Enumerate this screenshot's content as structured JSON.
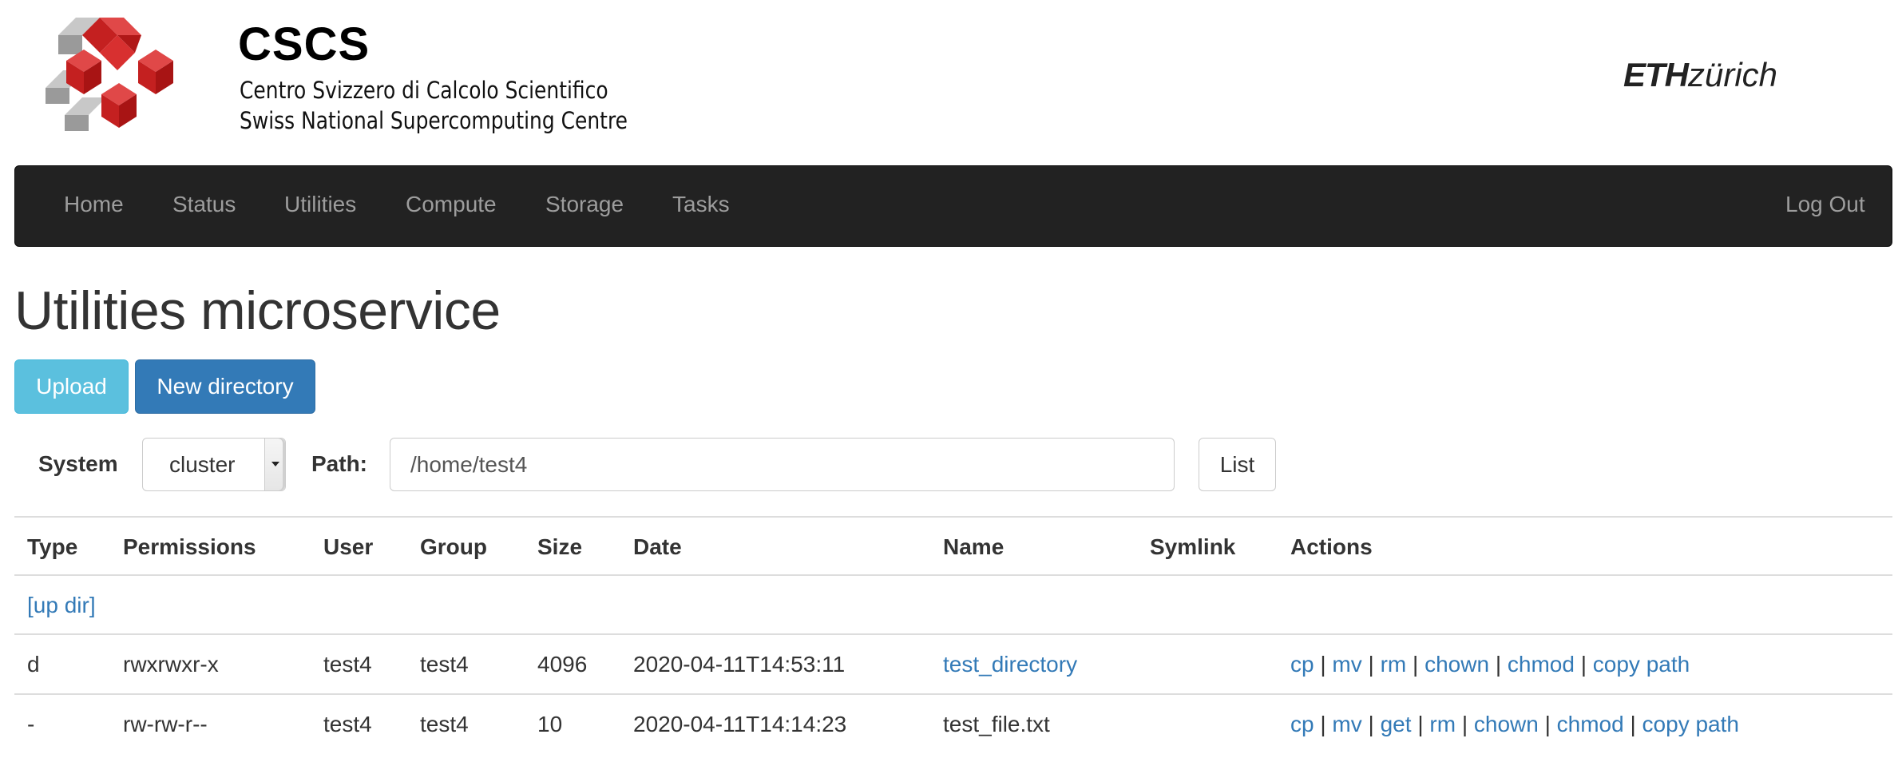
{
  "header": {
    "org_short": "CSCS",
    "org_line1": "Centro Svizzero di Calcolo Scientifico",
    "org_line2": "Swiss National Supercomputing Centre",
    "eth_bold": "ETH",
    "eth_italic": "zürich"
  },
  "nav": {
    "items": [
      "Home",
      "Status",
      "Utilities",
      "Compute",
      "Storage",
      "Tasks"
    ],
    "logout": "Log Out"
  },
  "page_title": "Utilities microservice",
  "buttons": {
    "upload": "Upload",
    "new_directory": "New directory",
    "list": "List"
  },
  "form": {
    "system_label": "System",
    "system_value": "cluster",
    "path_label": "Path:",
    "path_value": "/home/test4"
  },
  "table": {
    "headers": [
      "Type",
      "Permissions",
      "User",
      "Group",
      "Size",
      "Date",
      "Name",
      "Symlink",
      "Actions"
    ],
    "up_dir": "[up dir]",
    "rows": [
      {
        "type": "d",
        "permissions": "rwxrwxr-x",
        "user": "test4",
        "group": "test4",
        "size": "4096",
        "date": "2020-04-11T14:53:11",
        "name": "test_directory",
        "symlink": "",
        "actions": [
          "cp",
          "mv",
          "rm",
          "chown",
          "chmod",
          "copy path"
        ]
      },
      {
        "type": "-",
        "permissions": "rw-rw-r--",
        "user": "test4",
        "group": "test4",
        "size": "10",
        "date": "2020-04-11T14:14:23",
        "name": "test_file.txt",
        "symlink": "",
        "actions": [
          "cp",
          "mv",
          "get",
          "rm",
          "chown",
          "chmod",
          "copy path"
        ]
      }
    ],
    "action_separator": "|"
  },
  "colors": {
    "navbar_bg": "#222222",
    "nav_text": "#9d9d9d",
    "link": "#337ab7",
    "btn_info": "#5bc0de",
    "btn_primary": "#337ab7",
    "logo_red": "#d42a2a",
    "logo_gray": "#a8a8a8"
  }
}
